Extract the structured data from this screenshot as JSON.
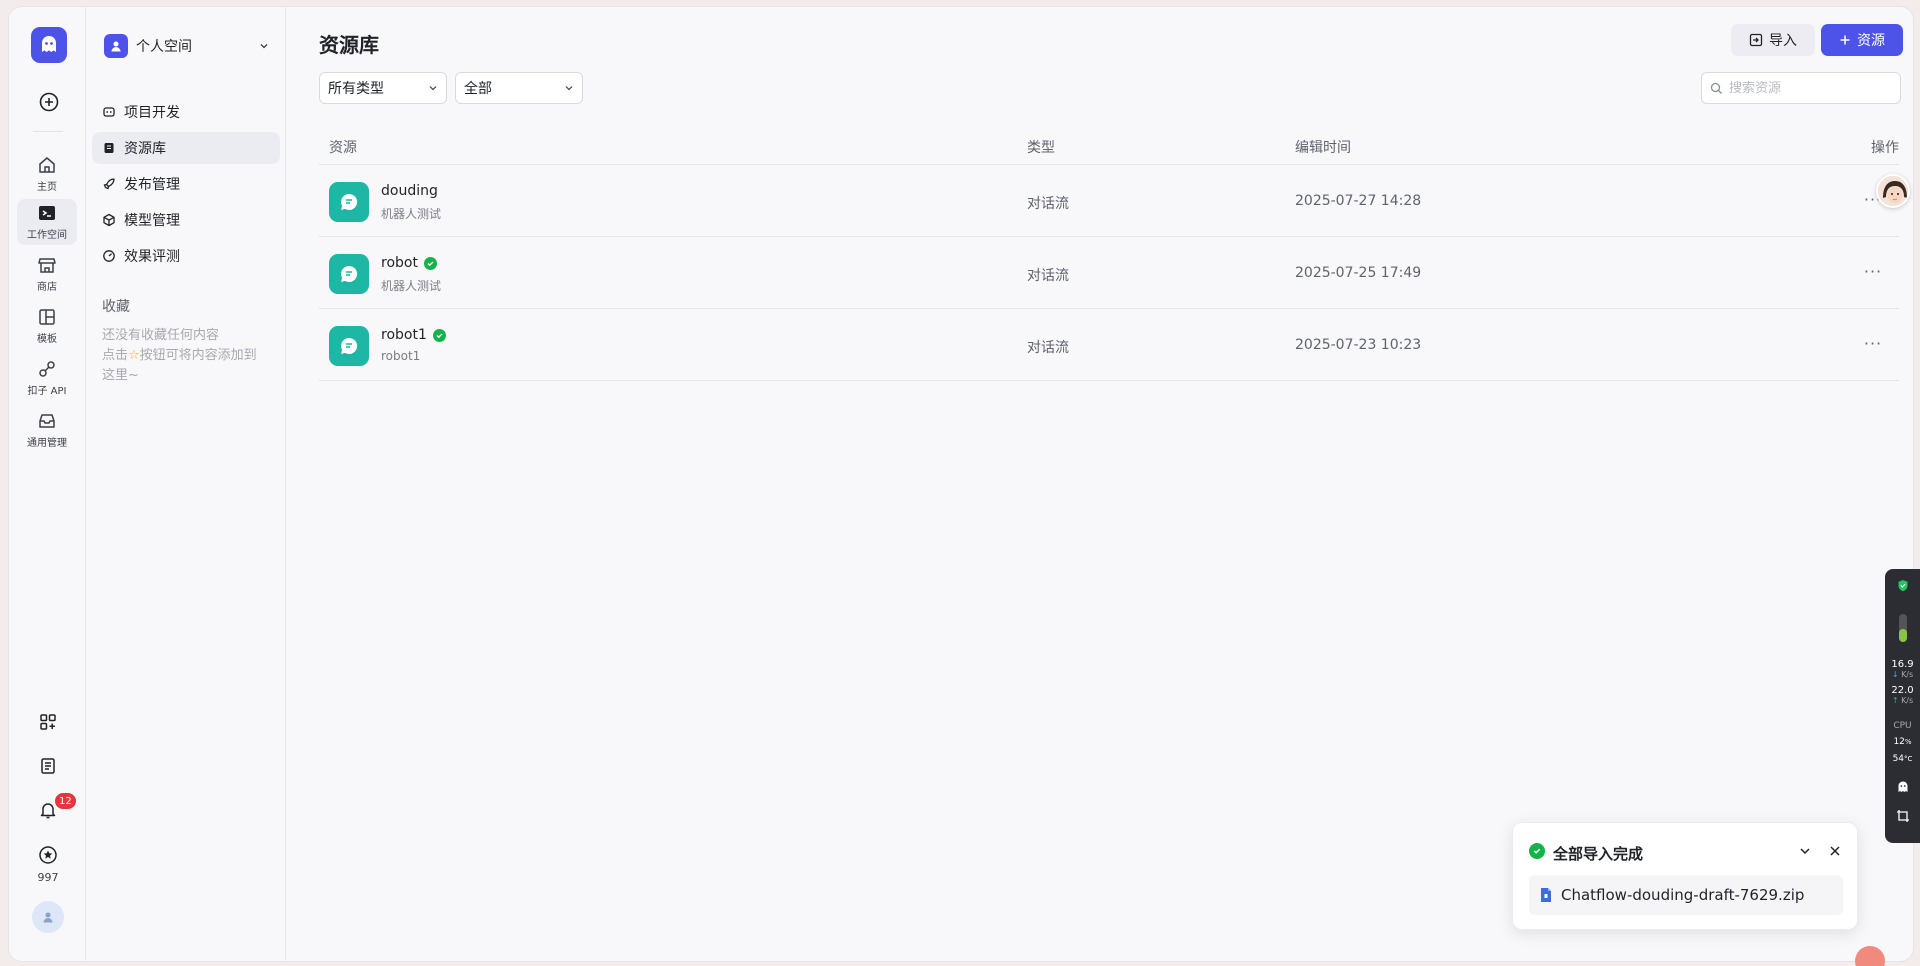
{
  "rail": {
    "items": [
      {
        "label": "主页",
        "icon": "home-icon"
      },
      {
        "label": "工作空间",
        "icon": "terminal-icon"
      },
      {
        "label": "商店",
        "icon": "store-icon"
      },
      {
        "label": "模板",
        "icon": "template-icon"
      },
      {
        "label": "扣子 API",
        "icon": "api-icon"
      },
      {
        "label": "通用管理",
        "icon": "inbox-icon"
      }
    ],
    "notification_count": "12",
    "points": "997"
  },
  "side": {
    "space_name": "个人空间",
    "nav": [
      {
        "label": "项目开发"
      },
      {
        "label": "资源库"
      },
      {
        "label": "发布管理"
      },
      {
        "label": "模型管理"
      },
      {
        "label": "效果评测"
      }
    ],
    "favorites_title": "收藏",
    "favorites_empty_line1": "还没有收藏任何内容",
    "favorites_empty_line2_prefix": "点击",
    "favorites_empty_line2_suffix": "按钮可将内容添加到",
    "favorites_empty_line3": "这里~"
  },
  "main": {
    "title": "资源库",
    "import_label": "导入",
    "new_label": "资源",
    "filter_type": "所有类型",
    "filter_scope": "全部",
    "search_placeholder": "搜索资源",
    "columns": {
      "resource": "资源",
      "type": "类型",
      "edited": "编辑时间",
      "actions": "操作"
    },
    "rows": [
      {
        "name": "douding",
        "desc": "机器人测试",
        "type": "对话流",
        "time": "2025-07-27 14:28",
        "published": false
      },
      {
        "name": "robot",
        "desc": "机器人测试",
        "type": "对话流",
        "time": "2025-07-25 17:49",
        "published": true
      },
      {
        "name": "robot1",
        "desc": "robot1",
        "type": "对话流",
        "time": "2025-07-23 10:23",
        "published": true
      }
    ],
    "more_glyph": "···"
  },
  "toast": {
    "title": "全部导入完成",
    "file": "Chatflow-douding-draft-7629.zip"
  },
  "monitor": {
    "down": "16.9",
    "down_unit": "K/s",
    "up": "22.0",
    "up_unit": "K/s",
    "cpu_label": "CPU",
    "cpu": "12",
    "cpu_unit": "%",
    "temp": "54",
    "temp_unit": "°C"
  },
  "colors": {
    "accent": "#4d53e8",
    "teal": "#1eb6a4",
    "success": "#13b34a"
  }
}
